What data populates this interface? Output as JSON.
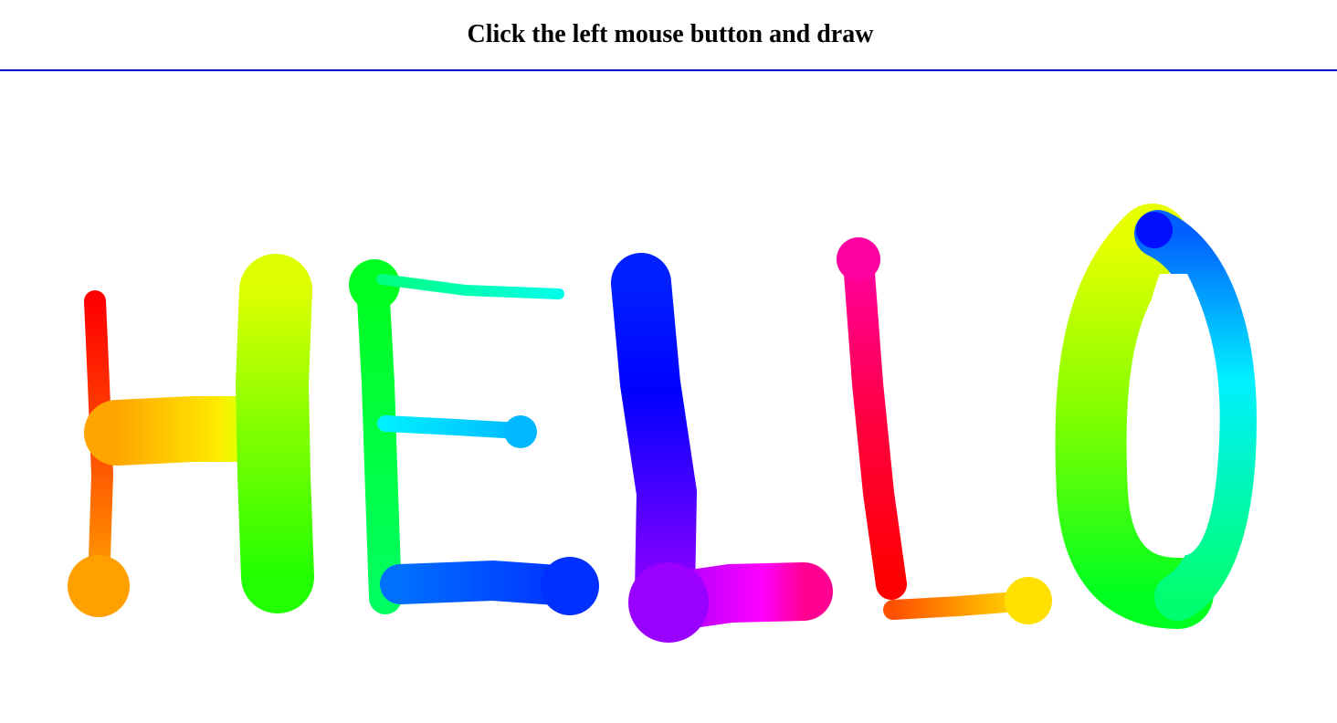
{
  "header": {
    "title": "Click the left mouse button and draw"
  },
  "canvas": {
    "background": "#ffffff",
    "divider_color": "#0000cc",
    "brush": "rainbow hue-cycling stroke with growing/shrinking width"
  }
}
